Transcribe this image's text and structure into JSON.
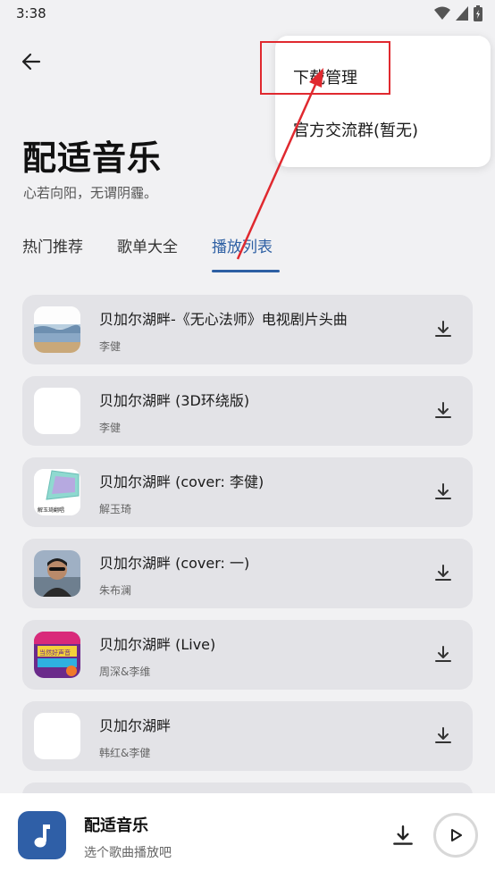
{
  "status_bar": {
    "time": "3:38"
  },
  "header": {
    "title": "配适音乐",
    "subtitle": "心若向阳，无谓阴霾。"
  },
  "tabs": [
    {
      "label": "热门推荐",
      "active": false
    },
    {
      "label": "歌单大全",
      "active": false
    },
    {
      "label": "播放列表",
      "active": true
    }
  ],
  "songs": [
    {
      "title": "贝加尔湖畔-《无心法师》电视剧片头曲",
      "artist": "李健",
      "cover": "landscape"
    },
    {
      "title": "贝加尔湖畔 (3D环绕版)",
      "artist": "李健",
      "cover": "blank"
    },
    {
      "title": "贝加尔湖畔 (cover: 李健)",
      "artist": "解玉琦",
      "cover": "mosaic",
      "cover_text": "解玉琦翻唱"
    },
    {
      "title": "贝加尔湖畔 (cover: 一)",
      "artist": "朱布澜",
      "cover": "portrait"
    },
    {
      "title": "贝加尔湖畔 (Live)",
      "artist": "周深&李维",
      "cover": "poster",
      "cover_text": "当然好声音"
    },
    {
      "title": "贝加尔湖畔",
      "artist": "韩红&李健",
      "cover": "blank"
    }
  ],
  "menu": {
    "items": [
      "下载管理",
      "官方交流群(暂无)"
    ]
  },
  "player": {
    "title": "配适音乐",
    "subtitle": "选个歌曲播放吧"
  },
  "colors": {
    "accent": "#2d5fa3",
    "annotation": "#e0292f",
    "background": "#f1f1f3",
    "card": "#e3e3e7"
  }
}
